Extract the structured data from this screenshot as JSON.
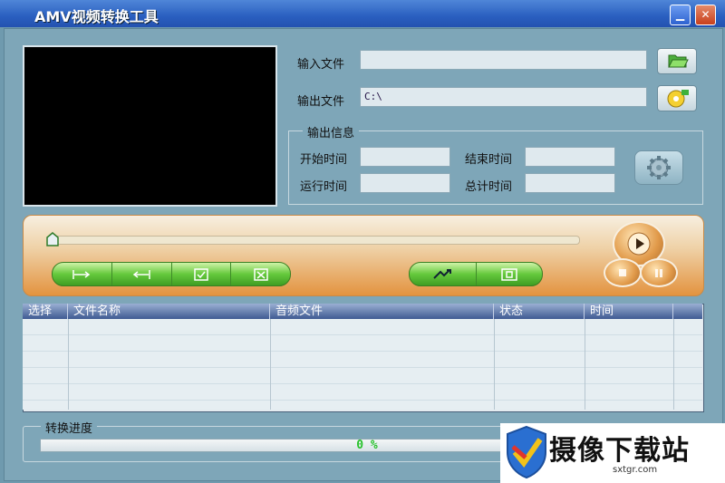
{
  "window": {
    "title": "AMV视频转换工具",
    "minimize_label": "▁",
    "close_label": "✕"
  },
  "files": {
    "input_label": "输入文件",
    "input_value": "",
    "output_label": "输出文件",
    "output_value": "C:\\"
  },
  "info": {
    "group_title": "输出信息",
    "start_label": "开始时间",
    "end_label": "结束时间",
    "run_label": "运行时间",
    "total_label": "总计时间",
    "start_value": "",
    "end_value": "",
    "run_value": "",
    "total_value": ""
  },
  "icons": {
    "open_folder": "folder-open-icon",
    "output_disc": "disc-icon",
    "settings": "gear-icon",
    "play": "play-icon",
    "stop": "stop-icon",
    "pause": "pause-icon"
  },
  "control": {
    "slider_progress": 0,
    "left_buttons": [
      "set-start",
      "set-end",
      "check",
      "uncheck"
    ],
    "right_buttons": [
      "convert",
      "fit"
    ]
  },
  "list": {
    "columns": [
      "选择",
      "文件名称",
      "音频文件",
      "状态",
      "时间"
    ],
    "rows": []
  },
  "progress": {
    "title": "转换进度",
    "percent_text": "0 %",
    "value": 0
  },
  "watermark": {
    "name": "摄像下载站",
    "url": "sxtgr.com"
  },
  "colors": {
    "title_bar": "#2a5fc0",
    "panel": "#7ea6b8",
    "accent_green": "#65c93c",
    "accent_orange": "#e3933f"
  }
}
